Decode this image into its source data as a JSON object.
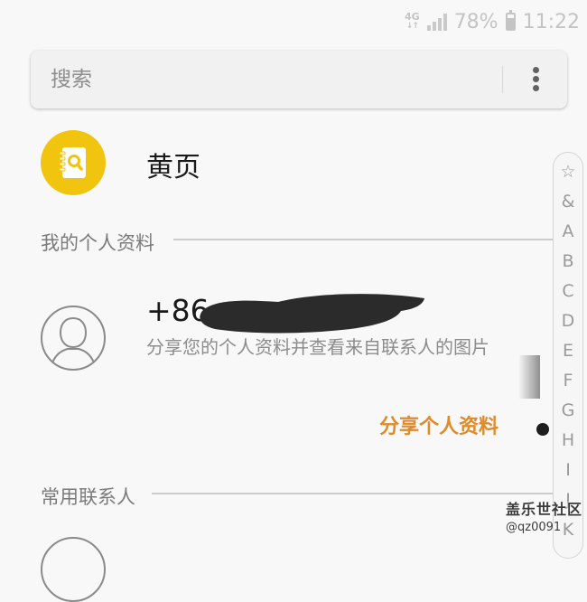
{
  "status_bar": {
    "network": "4G",
    "battery_percent": "78%",
    "battery_level": 0.78,
    "time": "11:22"
  },
  "search": {
    "placeholder": "搜索",
    "more_icon": "more-vertical-icon"
  },
  "yellow_pages": {
    "label": "黄页",
    "icon": "contact-book-search-icon",
    "color": "#f1c40f"
  },
  "sections": {
    "my_profile": "我的个人资料",
    "favorites": "常用联系人"
  },
  "profile": {
    "phone_prefix": "+86",
    "description": "分享您的个人资料并查看来自联系人的图片",
    "share_button": "分享个人资料",
    "share_color": "#e08a2a"
  },
  "index_bar": {
    "items": [
      "☆",
      "&",
      "A",
      "B",
      "C",
      "D",
      "E",
      "F",
      "G",
      "H",
      "I",
      "J",
      "K"
    ]
  },
  "watermark": {
    "title": "盖乐世社区",
    "user": "@qz0091"
  }
}
